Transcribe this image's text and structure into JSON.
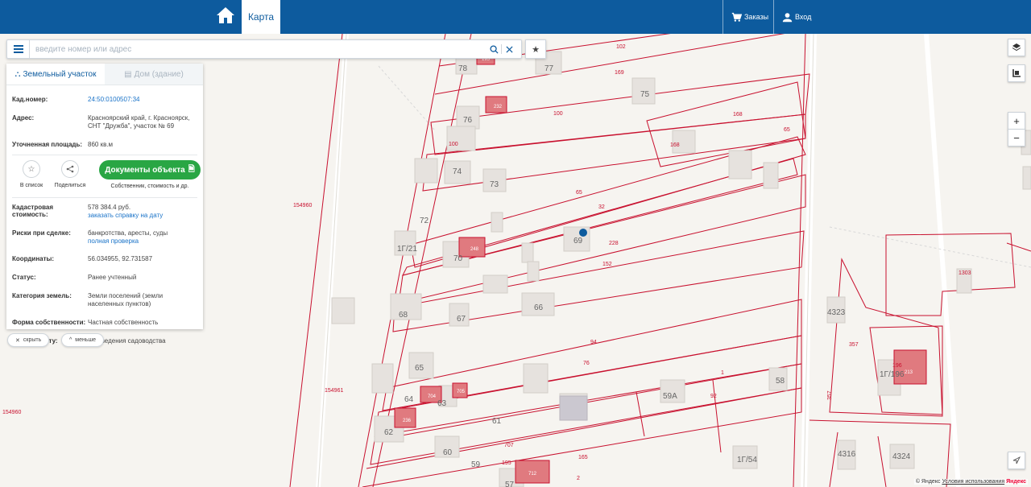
{
  "header": {
    "map_tab": "Карта",
    "orders_label": "Заказы",
    "login_label": "Вход"
  },
  "search": {
    "placeholder": "введите номер или адрес"
  },
  "panel": {
    "tab_land": "Земельный участок",
    "tab_house": "Дом (здание)",
    "rows_top": [
      {
        "label": "Кад.номер:",
        "value": "24:50:0100507:34",
        "link": true
      },
      {
        "label": "Адрес:",
        "value": "Красноярский край, г. Красноярск, СНТ \"Дружба\", участок № 69",
        "link": false
      },
      {
        "label": "Уточненная площадь:",
        "value": "860 кв.м",
        "link": false
      }
    ],
    "add_to_list": "В список",
    "share": "Поделиться",
    "documents_button": "Документы объекта",
    "documents_sub": "Собственник, стоимость и др.",
    "cadastral_value_label": "Кадастровая стоимость:",
    "cadastral_value": "578 384.4 руб.",
    "cadastral_value_link": "заказать справку на дату",
    "risks_label": "Риски при сделке:",
    "risks_value": "банкротства, аресты, суды",
    "risks_link": "полная проверка",
    "coords_label": "Координаты:",
    "coords_value": "56.034955, 92.731587",
    "status_label": "Статус:",
    "status_value": "Ранее учтенный",
    "category_label": "Категория земель:",
    "category_value": "Земли поселений (земли населенных пунктов)",
    "ownership_label": "Форма собственности:",
    "ownership_value": "Частная собственность",
    "document_label": "по документу:",
    "document_value": "Для ведения садоводства"
  },
  "pills": {
    "hide": "скрыть",
    "less": "меньше"
  },
  "map_controls": {
    "zoom_in": "+",
    "zoom_out": "−"
  },
  "copyright": {
    "yandex": "© Яндекс",
    "terms": "Условия использования",
    "logo": "Яндекс"
  },
  "map_labels": {
    "parcels": [
      "78",
      "77",
      "75",
      "76",
      "74",
      "73",
      "72",
      "1Г/21",
      "70",
      "69",
      "68",
      "67",
      "66",
      "65",
      "64",
      "63",
      "62",
      "61",
      "60",
      "59",
      "57",
      "58",
      "59А",
      "1Г/54",
      "4323",
      "1Г/196",
      "4316",
      "4324"
    ],
    "red_numbers": [
      "102",
      "169",
      "100",
      "168",
      "65",
      "168",
      "100",
      "65",
      "32",
      "228",
      "152",
      "94",
      "76",
      "1",
      "92",
      "707",
      "195",
      "165",
      "2",
      "357",
      "1303",
      "196",
      "154960",
      "154961",
      "154960"
    ],
    "tags": [
      "195",
      "232",
      "248",
      "704",
      "705",
      "236",
      "712",
      "213"
    ]
  },
  "colors": {
    "header": "#0d5b9e",
    "parcel_line": "#c8102e",
    "building_red": "#e07a7f",
    "doc_button": "#29a644"
  }
}
